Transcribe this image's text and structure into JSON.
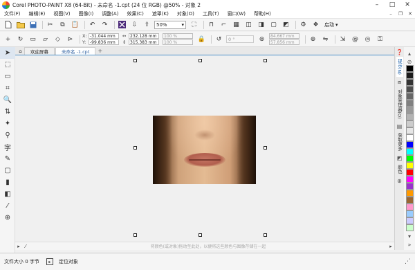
{
  "window": {
    "title": "Corel PHOTO-PAINT X8 (64-Bit) - 未命名 -1.cpt (24 位 RGB) @50% - 对象 2",
    "minimize": "–",
    "maximize": "□",
    "close": "✕"
  },
  "menu": {
    "items": [
      "文件(F)",
      "编辑(E)",
      "视图(V)",
      "图像(I)",
      "调整(A)",
      "效果(C)",
      "遮罩(K)",
      "对象(O)",
      "工具(T)",
      "窗口(W)",
      "帮助(H)"
    ],
    "ctrl_min": "–",
    "ctrl_restore": "❐",
    "ctrl_close": "✕"
  },
  "toolbar": {
    "zoom": "50%",
    "launch_label": "启动"
  },
  "property_bar": {
    "x_label": "X:",
    "x_value": "-31.044 mm",
    "y_label": "Y:",
    "y_value": "-99.836 mm",
    "w_value": "232.128 mm",
    "h_value": "315.383 mm",
    "scale_w": "100 %",
    "scale_h": "100 %",
    "angle": "0 °",
    "size_w": "84.667 mm",
    "size_h": "57.856 mm"
  },
  "tabs": {
    "welcome": "欢迎屏幕",
    "document": "未命名 -1.cpt",
    "add": "+"
  },
  "canvas": {
    "hint": "将颜色(或对象)拖动至此处，以便将这些颜色与图像存储在一起"
  },
  "side_tabs": [
    "提示(N)",
    "对象管理器(O)",
    "获取更多",
    "颜色"
  ],
  "palette": {
    "colors": [
      "#000000",
      "#1a1a1a",
      "#333333",
      "#4d4d4d",
      "#666666",
      "#808080",
      "#999999",
      "#b3b3b3",
      "#cccccc",
      "#e6e6e6",
      "#ffffff",
      "#0000ff",
      "#00ffff",
      "#00ff00",
      "#ffff00",
      "#ff0000",
      "#ff00ff",
      "#9933cc",
      "#ff9900",
      "#996633",
      "#ff99cc",
      "#99ccff",
      "#ccccff",
      "#ccffcc"
    ]
  },
  "status": {
    "file_size": "文件大小 0 字节",
    "mode": "定位对象"
  }
}
